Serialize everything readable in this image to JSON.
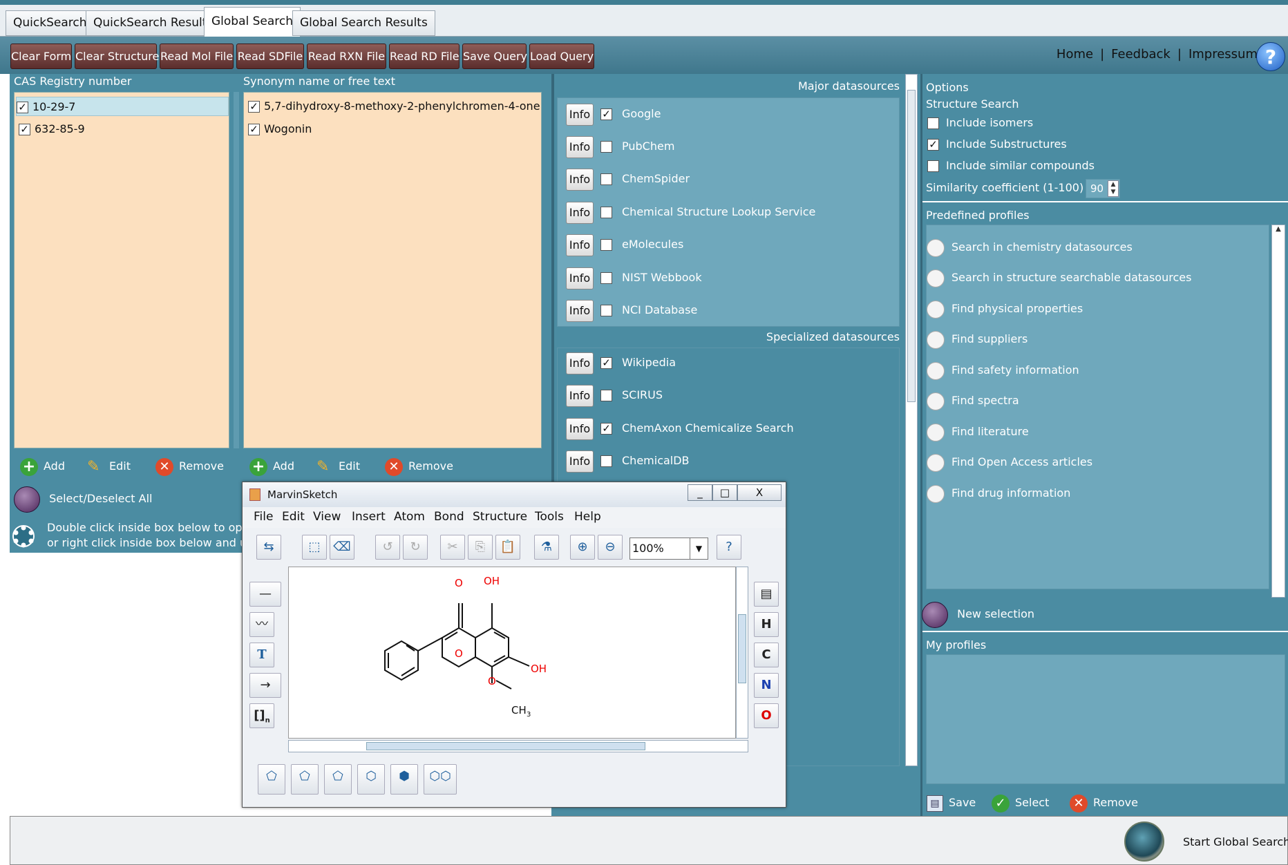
{
  "tabs": [
    {
      "label": "QuickSearch"
    },
    {
      "label": "QuickSearch Results"
    },
    {
      "label": "Global Search"
    },
    {
      "label": "Global Search Results"
    }
  ],
  "toolbar": {
    "buttons": [
      "Clear Form",
      "Clear Structure",
      "Read Mol File",
      "Read SDFile",
      "Read RXN File",
      "Read RD File",
      "Save Query",
      "Load Query"
    ],
    "links": [
      "Home",
      "Feedback",
      "Impressum"
    ],
    "sep": "|",
    "help": "?"
  },
  "cas": {
    "title": "CAS Registry number",
    "items": [
      {
        "label": "10-29-7",
        "checked": true
      },
      {
        "label": "632-85-9",
        "checked": true
      }
    ]
  },
  "synonym": {
    "title": "Synonym name or free text",
    "items": [
      {
        "label": "5,7-dihydroxy-8-methoxy-2-phenylchromen-4-one",
        "checked": true
      },
      {
        "label": "Wogonin",
        "checked": true
      }
    ]
  },
  "actions": {
    "add": "Add",
    "edit": "Edit",
    "remove": "Remove"
  },
  "select_all": "Select/Deselect All",
  "hint": {
    "line1": "Double click inside box below to open",
    "line2": "or right click inside box below and use"
  },
  "major": {
    "title": "Major datasources",
    "items": [
      {
        "label": "Google",
        "checked": true
      },
      {
        "label": "PubChem",
        "checked": false
      },
      {
        "label": "ChemSpider",
        "checked": false
      },
      {
        "label": "Chemical Structure Lookup Service",
        "checked": false
      },
      {
        "label": "eMolecules",
        "checked": false
      },
      {
        "label": "NIST Webbook",
        "checked": false
      },
      {
        "label": "NCI Database",
        "checked": false
      }
    ]
  },
  "specialized": {
    "title": "Specialized datasources",
    "items": [
      {
        "label": "Wikipedia",
        "checked": true
      },
      {
        "label": "SCIRUS",
        "checked": false
      },
      {
        "label": "ChemAxon Chemicalize Search",
        "checked": true
      },
      {
        "label": "ChemicalDB",
        "checked": false
      }
    ]
  },
  "info_label": "Info",
  "options": {
    "title": "Options",
    "structure_search": "Structure Search",
    "include_isomers": "Include isomers",
    "include_substructures": "Include Substructures",
    "include_similar": "Include similar compounds",
    "similarity_label": "Similarity coefficient (1-100)",
    "similarity_value": "90"
  },
  "profiles": {
    "title": "Predefined profiles",
    "items": [
      "Search in chemistry datasources",
      "Search in structure searchable datasources",
      "Find physical properties",
      "Find suppliers",
      "Find safety information",
      "Find spectra",
      "Find literature",
      "Find Open Access articles",
      "Find drug information"
    ],
    "new_selection": "New selection",
    "my_profiles": "My profiles",
    "save": "Save",
    "select": "Select",
    "remove": "Remove"
  },
  "start_search": "Start Global Search",
  "marvin": {
    "title": "MarvinSketch",
    "menu": [
      "File",
      "Edit",
      "View",
      "Insert",
      "Atom",
      "Bond",
      "Structure",
      "Tools",
      "Help"
    ],
    "zoom": "100%",
    "atoms": {
      "o1": "O",
      "oh1": "OH",
      "o2": "O",
      "oh2": "OH",
      "o3": "O",
      "ch3": "CH",
      "ch3_sub": "3"
    },
    "right_tools": [
      "H",
      "C",
      "N",
      "O"
    ],
    "bracket_tool": "[]",
    "bracket_sub": "n",
    "text_tool": "T",
    "min": "_",
    "max": "□",
    "close": "X"
  },
  "colors": {
    "panel": "#4b8ca2",
    "list_bg": "#fce0bf",
    "ds_box": "#6fa8bc",
    "toolbar_btn": "#6b3b38"
  }
}
